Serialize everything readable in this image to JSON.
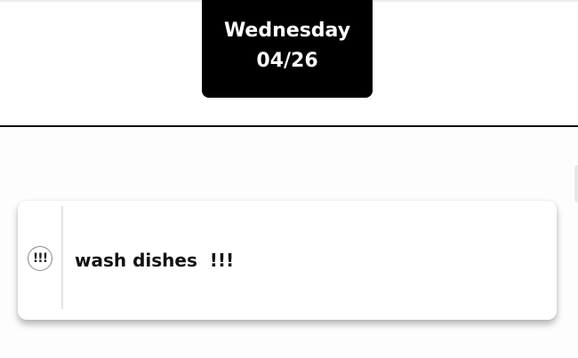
{
  "header": {
    "day": "Wednesday",
    "date": "04/26"
  },
  "task": {
    "priority_icon": "!!!",
    "title": "wash dishes  !!!"
  },
  "colors": {
    "badge_background": "#000000",
    "badge_text": "#ffffff",
    "divider": "#111111",
    "card_background": "#ffffff"
  },
  "icons": {
    "priority": "priority-exclamation-icon"
  }
}
